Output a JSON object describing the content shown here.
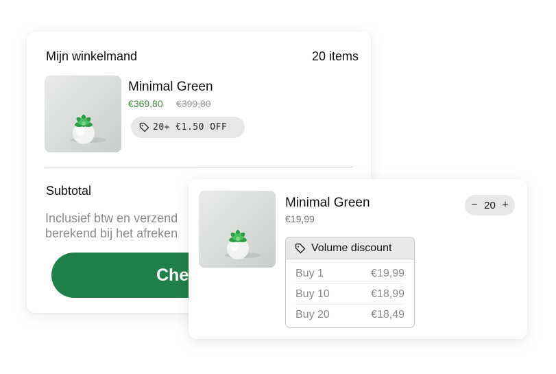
{
  "cart": {
    "title": "Mijn winkelmand",
    "count": "20 items",
    "product": {
      "name": "Minimal Green",
      "price": "€369,80",
      "old_price": "€399,80",
      "discount": "20+ €1.50 OFF",
      "image_icon": "succulent-plant-image"
    },
    "subtotal_label": "Subtotal",
    "tax_note": "Inclusief btw en verzend berekend bij het afreken",
    "checkout_label": "Che"
  },
  "detail": {
    "product": {
      "name": "Minimal Green",
      "unit_price": "€19,99",
      "image_icon": "succulent-plant-image"
    },
    "quantity": {
      "decrement": "−",
      "value": "20",
      "increment": "+"
    },
    "volume_discount": {
      "title": "Volume discount",
      "icon": "tag-icon",
      "tiers": [
        {
          "label": "Buy 1",
          "price": "€19,99"
        },
        {
          "label": "Buy 10",
          "price": "€18,99"
        },
        {
          "label": "Buy 20",
          "price": "€18,49"
        }
      ]
    }
  },
  "colors": {
    "accent_green": "#20804a",
    "price_green": "#3f8a3f"
  }
}
